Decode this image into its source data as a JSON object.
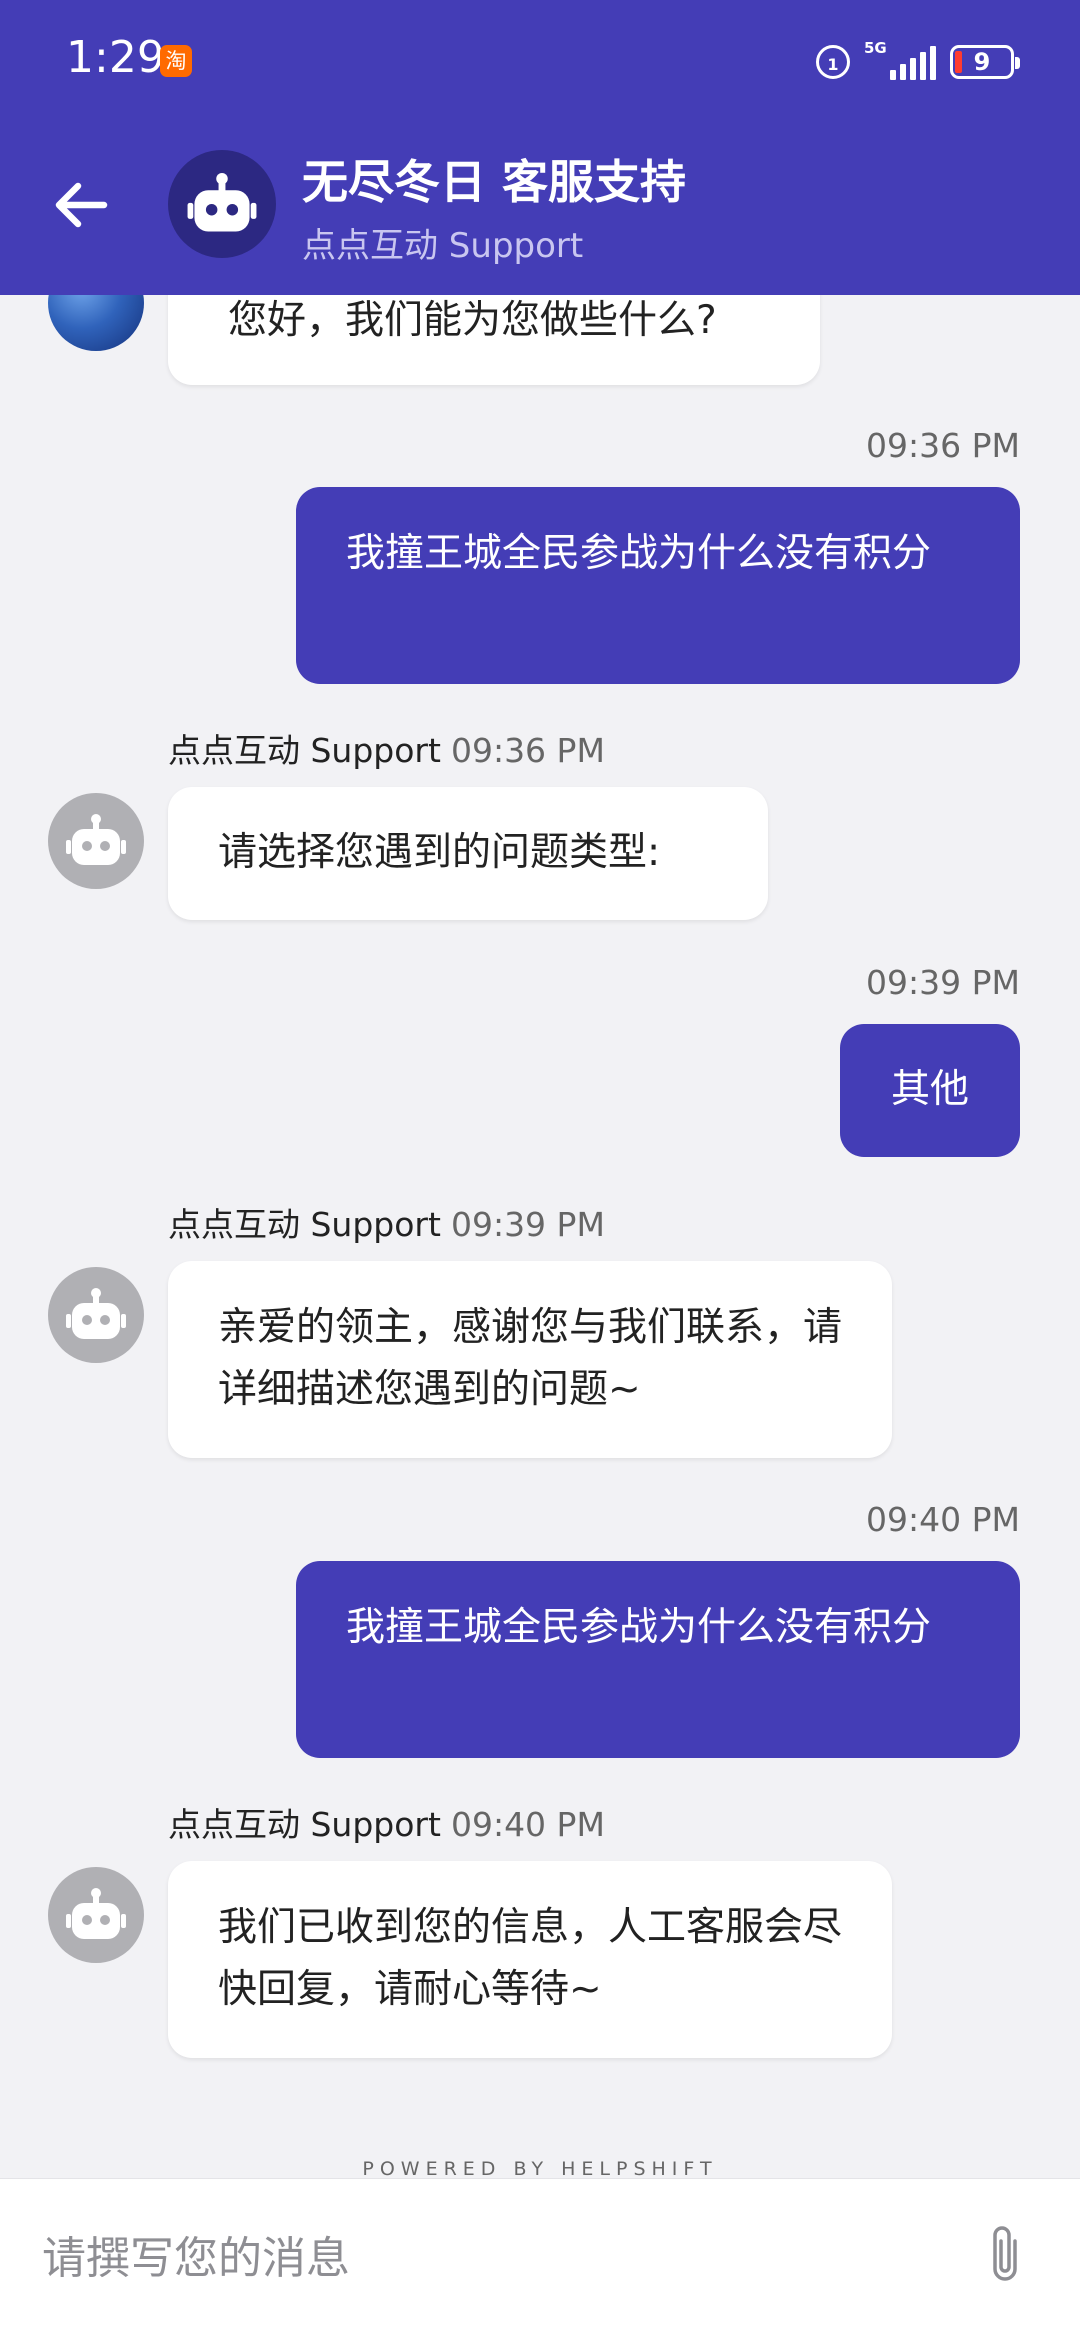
{
  "status_bar": {
    "time": "1:29",
    "taobao_badge": "淘",
    "hd_label": "1",
    "network_label": "5G",
    "battery_level": "9"
  },
  "header": {
    "title": "无尽冬日 客服支持",
    "subtitle": "点点互动 Support",
    "back_icon": "arrow-left-icon",
    "avatar_icon": "robot-icon",
    "background_color": "#443db6"
  },
  "messages": [
    {
      "direction": "incoming",
      "text": "您好，我们能为您做些什么?"
    },
    {
      "direction": "outgoing",
      "time": "09:36 PM",
      "text": "我撞王城全民参战为什么没有积分"
    },
    {
      "direction": "incoming",
      "sender": "点点互动 Support",
      "time": "09:36 PM",
      "text": "请选择您遇到的问题类型:"
    },
    {
      "direction": "outgoing",
      "time": "09:39 PM",
      "text": "其他"
    },
    {
      "direction": "incoming",
      "sender": "点点互动 Support",
      "time": "09:39 PM",
      "text": "亲爱的领主，感谢您与我们联系，请详细描述您遇到的问题~"
    },
    {
      "direction": "outgoing",
      "time": "09:40 PM",
      "text": "我撞王城全民参战为什么没有积分"
    },
    {
      "direction": "incoming",
      "sender": "点点互动 Support",
      "time": "09:40 PM",
      "text": "我们已收到您的信息，人工客服会尽快回复，请耐心等待~"
    }
  ],
  "footer": {
    "powered_by": "POWERED BY HELPSHIFT"
  },
  "composer": {
    "placeholder": "请撰写您的消息",
    "value": "",
    "attach_icon": "paperclip-icon"
  },
  "colors": {
    "accent": "#443db6",
    "chat_background": "#f2f2f5",
    "incoming_bubble": "#ffffff",
    "outgoing_bubble": "#443db6"
  }
}
